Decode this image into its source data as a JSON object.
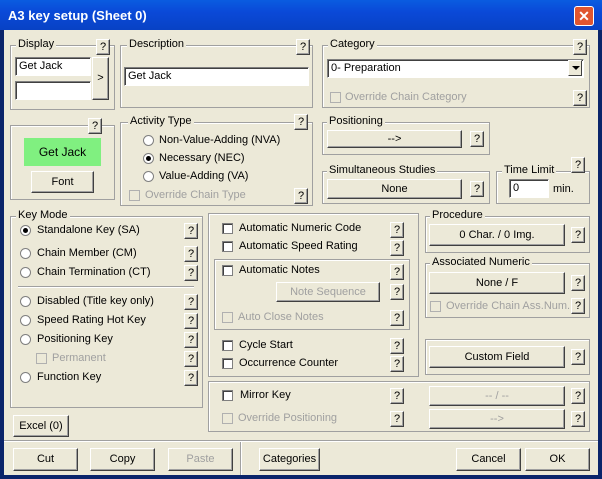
{
  "window": {
    "title": "A3 key setup (Sheet 0)",
    "close": "✕"
  },
  "display": {
    "title": "Display",
    "help": "?",
    "line1": "Get Jack",
    "line2": "",
    "arrow": ">",
    "preview_help": "?",
    "preview_text": "Get Jack",
    "preview_color": "#80f080",
    "font_button": "Font"
  },
  "description": {
    "title": "Description",
    "help": "?",
    "value": "Get Jack"
  },
  "category": {
    "title": "Category",
    "help": "?",
    "value": "0- Preparation",
    "override_label": "Override Chain Category",
    "override_help": "?"
  },
  "activity": {
    "title": "Activity Type",
    "help": "?",
    "options": [
      {
        "label": "Non-Value-Adding (NVA)",
        "selected": false
      },
      {
        "label": "Necessary (NEC)",
        "selected": true
      },
      {
        "label": "Value-Adding (VA)",
        "selected": false
      }
    ],
    "override_label": "Override Chain Type",
    "override_help": "?"
  },
  "positioning": {
    "title": "Positioning",
    "button": "-->",
    "help": "?"
  },
  "simultaneous": {
    "title": "Simultaneous Studies",
    "button": "None",
    "help": "?"
  },
  "timelimit": {
    "title": "Time Limit",
    "help": "?",
    "value": "0",
    "unit": "min."
  },
  "keymode": {
    "title": "Key Mode",
    "options": [
      {
        "label": "Standalone Key  (SA)",
        "selected": true,
        "help": "?"
      },
      {
        "label": "Chain Member  (CM)",
        "selected": false,
        "help": "?"
      },
      {
        "label": "Chain Termination  (CT)",
        "selected": false,
        "help": "?"
      }
    ],
    "options2": [
      {
        "label": "Disabled (Title key only)",
        "selected": false,
        "help": "?"
      },
      {
        "label": "Speed Rating Hot Key",
        "selected": false,
        "help": "?"
      },
      {
        "label": "Positioning Key",
        "selected": false,
        "help": "?"
      }
    ],
    "permanent_label": "Permanent",
    "permanent_help": "?",
    "function_label": "Function Key",
    "function_help": "?"
  },
  "middle": {
    "auto_numeric": "Automatic Numeric Code",
    "auto_speed": "Automatic Speed Rating",
    "auto_notes": "Automatic Notes",
    "note_sequence": "Note Sequence",
    "auto_close": "Auto Close Notes",
    "cycle_start": "Cycle Start",
    "occurrence": "Occurrence Counter",
    "help": "?"
  },
  "procedure": {
    "title": "Procedure",
    "button": "0 Char. / 0 Img.",
    "help": "?"
  },
  "assoc": {
    "title": "Associated Numeric",
    "button": "None / F",
    "help": "?",
    "override_label": "Override Chain Ass.Num.",
    "override_help": "?"
  },
  "custom_field": {
    "button": "Custom Field",
    "help": "?"
  },
  "mirror": {
    "label": "Mirror Key",
    "override_label": "Override Positioning",
    "button1": "-- / --",
    "button2": "-->",
    "help": "?"
  },
  "excel": "Excel (0)",
  "bottom": {
    "cut": "Cut",
    "copy": "Copy",
    "paste": "Paste",
    "categories": "Categories",
    "cancel": "Cancel",
    "ok": "OK"
  }
}
